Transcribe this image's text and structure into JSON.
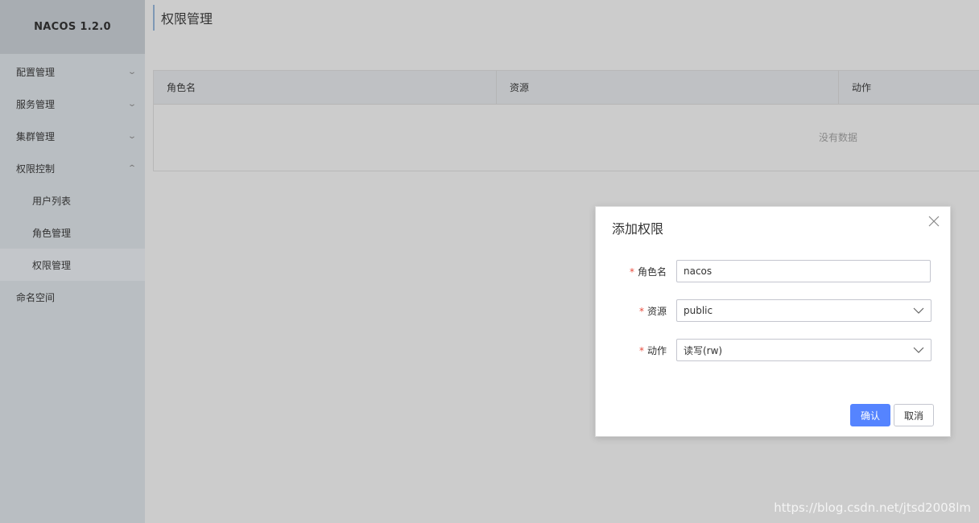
{
  "app": {
    "title": "NACOS 1.2.0"
  },
  "sidebar": {
    "items": [
      {
        "label": "配置管理",
        "icon": "chevron-down-icon"
      },
      {
        "label": "服务管理",
        "icon": "chevron-down-icon"
      },
      {
        "label": "集群管理",
        "icon": "chevron-down-icon"
      },
      {
        "label": "权限控制",
        "icon": "chevron-up-icon"
      },
      {
        "label": "命名空间"
      }
    ],
    "sub_items": [
      {
        "label": "用户列表"
      },
      {
        "label": "角色管理"
      },
      {
        "label": "权限管理",
        "active": true
      }
    ]
  },
  "page": {
    "title": "权限管理"
  },
  "table": {
    "columns": [
      "角色名",
      "资源",
      "动作"
    ],
    "empty_text": "没有数据"
  },
  "dialog": {
    "title": "添加权限",
    "fields": {
      "role": {
        "label": "角色名",
        "value": "nacos"
      },
      "resource": {
        "label": "资源",
        "value": "public"
      },
      "action": {
        "label": "动作",
        "value": "读写(rw)"
      }
    },
    "ok_label": "确认",
    "cancel_label": "取消"
  },
  "watermark": "https://blog.csdn.net/jtsd2008lm",
  "colors": {
    "primary": "#5584ff",
    "required": "#e84b3c",
    "sidebar": "#b9bec2"
  }
}
